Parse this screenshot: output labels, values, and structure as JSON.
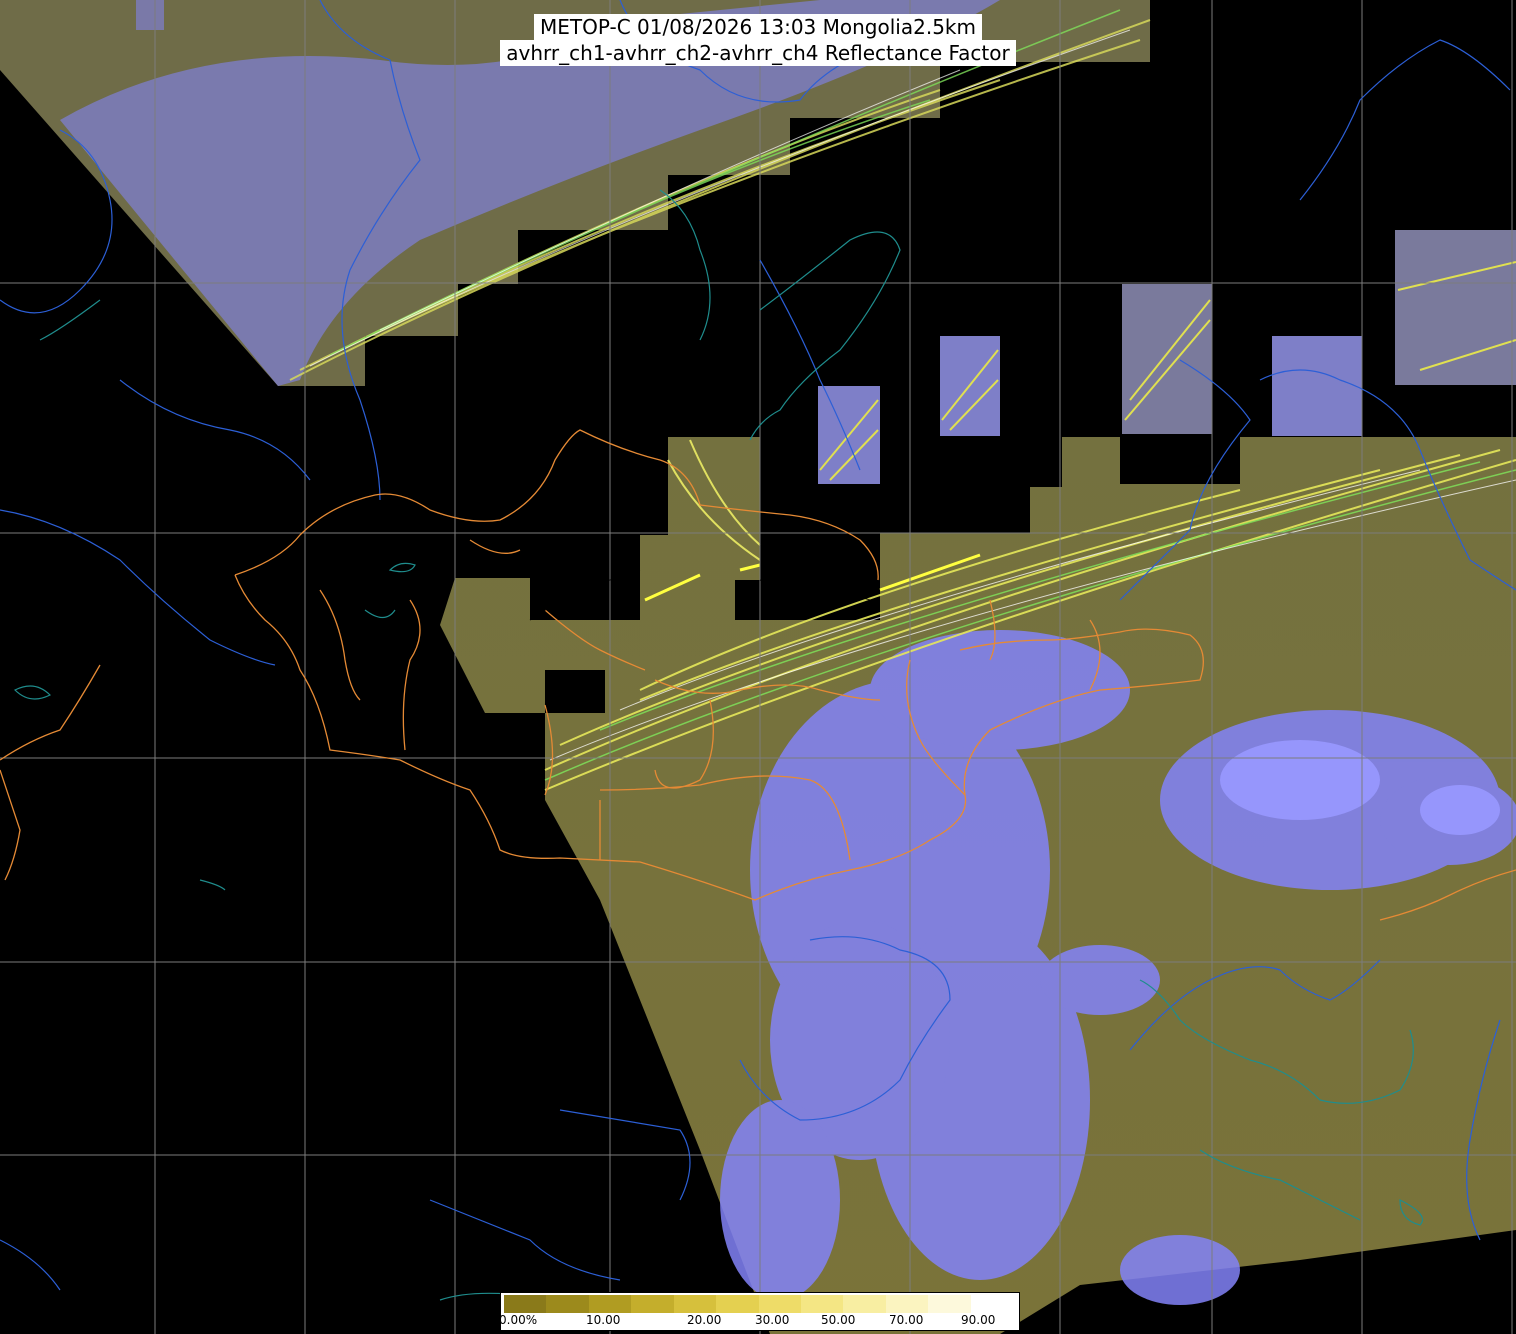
{
  "title": {
    "line1": "METOP-C 01/08/2026 13:03 Mongolia2.5km",
    "line2": "avhrr_ch1-avhrr_ch2-avhrr_ch4 Reflectance Factor"
  },
  "colorbar": {
    "ticks": [
      "0.00%",
      "10.00",
      "20.00",
      "30.00",
      "50.00",
      "70.00",
      "90.00"
    ],
    "colors": [
      "#8a7a1a",
      "#9c8a1c",
      "#b09c22",
      "#c4ae2c",
      "#d6c03c",
      "#e4d050",
      "#eedc68",
      "#f4e684",
      "#f8eea2",
      "#fbf4c0",
      "#fdf9dc",
      "#ffffff"
    ]
  },
  "colors": {
    "background": "#000000",
    "land": "#6f6a3c",
    "cloud": "#8080ff",
    "grid": "#808080",
    "coastline": "#1f5fcf",
    "borders": "#e08030",
    "lakes": "#1f8a8a"
  }
}
